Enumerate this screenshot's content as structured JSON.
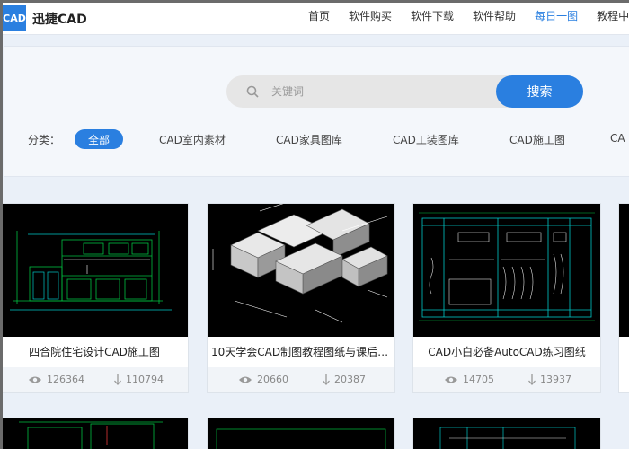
{
  "header": {
    "logo_text": "CAD",
    "brand": "迅捷CAD",
    "nav": [
      {
        "label": "首页",
        "active": false
      },
      {
        "label": "软件购买",
        "active": false
      },
      {
        "label": "软件下载",
        "active": false
      },
      {
        "label": "软件帮助",
        "active": false
      },
      {
        "label": "每日一图",
        "active": true
      },
      {
        "label": "教程中",
        "active": false
      }
    ]
  },
  "search": {
    "placeholder": "关键词",
    "button_label": "搜索"
  },
  "categories": {
    "label": "分类：",
    "items": [
      "全部",
      "CAD室内素材",
      "CAD家具图库",
      "CAD工装图库",
      "CAD施工图",
      "CA"
    ]
  },
  "cards": [
    {
      "title": "四合院住宅设计CAD施工图",
      "views": "126364",
      "downloads": "110794"
    },
    {
      "title": "10天学会CAD制图教程图纸与课后配...",
      "views": "20660",
      "downloads": "20387"
    },
    {
      "title": "CAD小白必备AutoCAD练习图纸",
      "views": "14705",
      "downloads": "13937"
    }
  ],
  "colors": {
    "accent": "#2a7fe0",
    "cad_line_green": "#00c040",
    "cad_line_cyan": "#00c8c8"
  }
}
